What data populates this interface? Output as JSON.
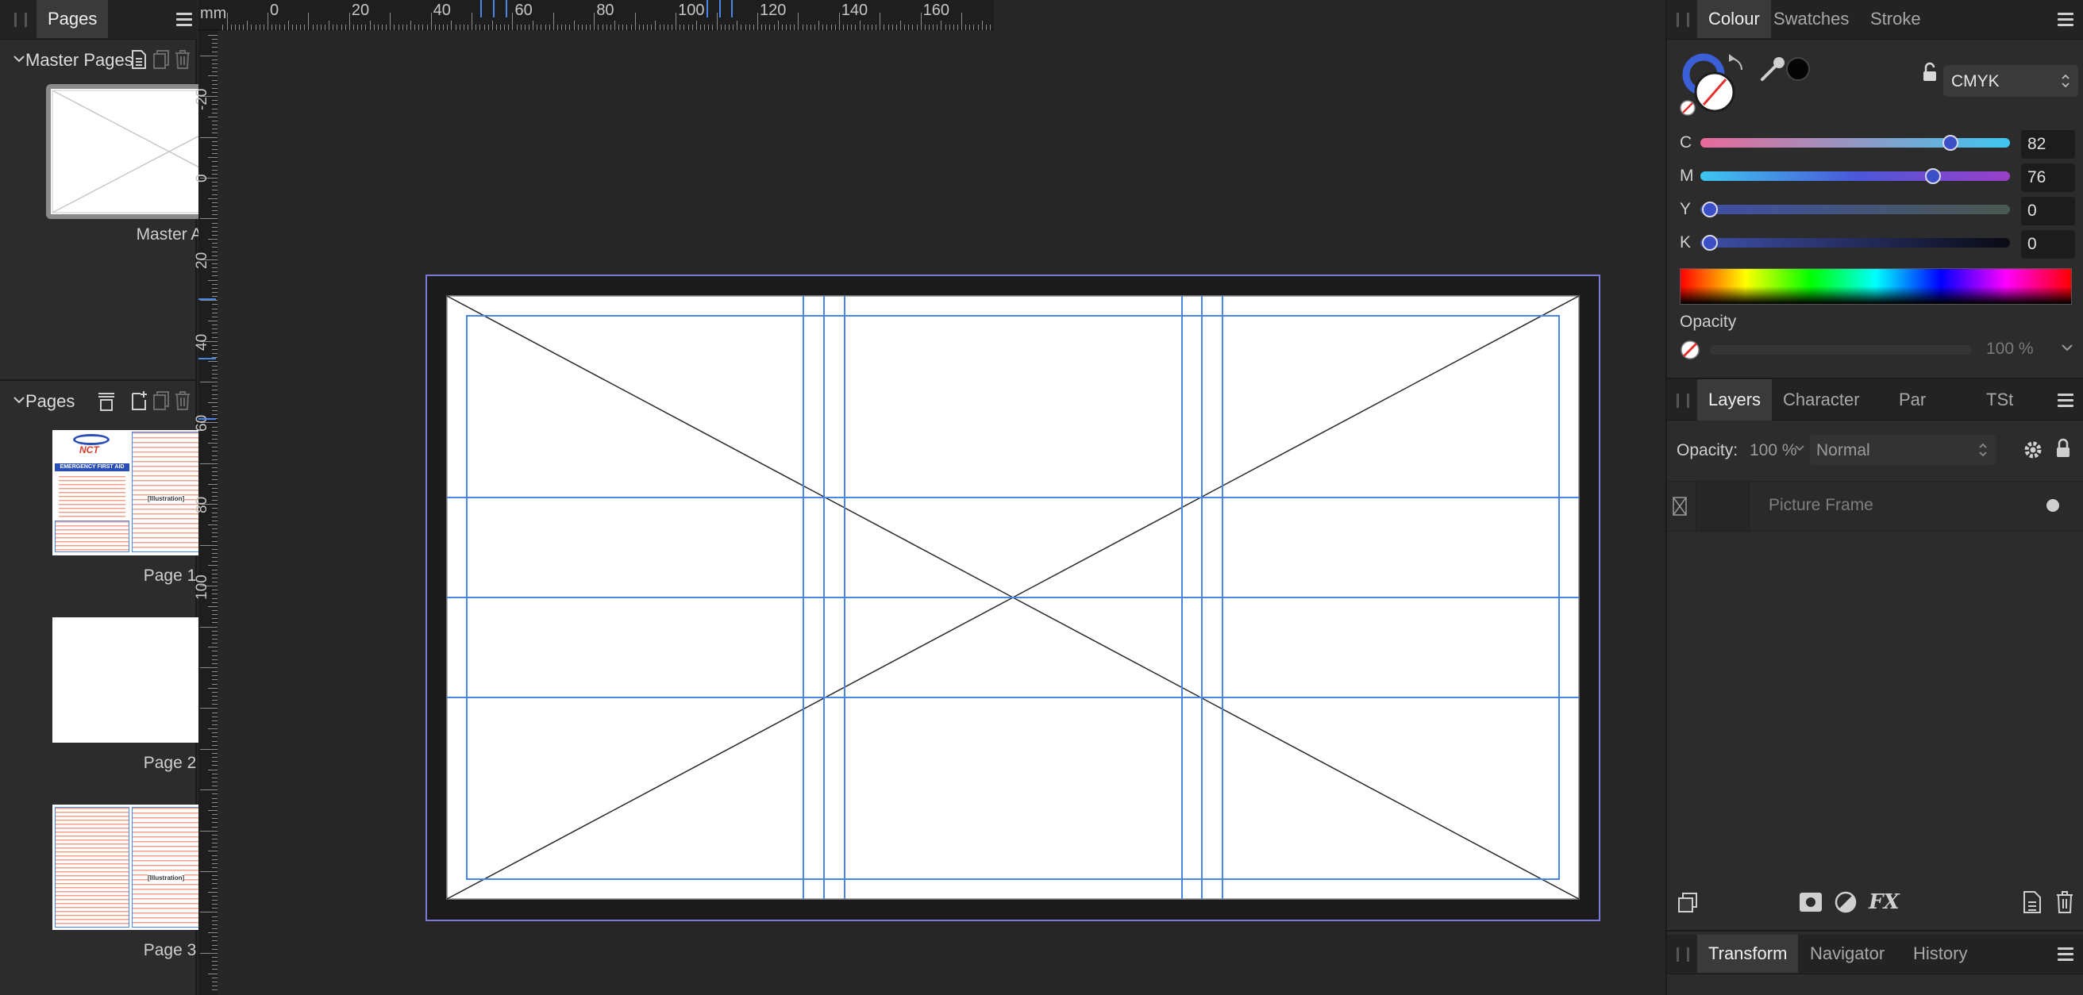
{
  "pages_panel": {
    "tab_label": "Pages",
    "master_section_title": "Master Pages",
    "master_pages": [
      {
        "label": "Master A"
      }
    ],
    "pages_section_title": "Pages",
    "pages": [
      {
        "label": "Page 1"
      },
      {
        "label": "Page 2"
      },
      {
        "label": "Page 3"
      }
    ],
    "page1_thumb": {
      "logo": "NCT",
      "banner": "EMERGENCY FIRST AID",
      "illustration": "[Illustration]"
    },
    "page3_thumb": {
      "illustration": "[Illustration]"
    }
  },
  "ruler": {
    "unit": "mm",
    "top_labels": [
      "0",
      "20",
      "40",
      "60",
      "80",
      "100",
      "120",
      "140",
      "160"
    ],
    "left_labels": [
      "-20",
      "0",
      "20",
      "40",
      "60",
      "80",
      "100"
    ]
  },
  "colour_panel": {
    "tabs": [
      "Colour",
      "Swatches",
      "Stroke"
    ],
    "active_tab": "Colour",
    "colour_model": "CMYK",
    "sliders": [
      {
        "label": "C",
        "value": "82",
        "fraction": 0.82
      },
      {
        "label": "M",
        "value": "76",
        "fraction": 0.76
      },
      {
        "label": "Y",
        "value": "0",
        "fraction": 0
      },
      {
        "label": "K",
        "value": "0",
        "fraction": 0
      }
    ],
    "opacity_label": "Opacity",
    "opacity_value": "100 %"
  },
  "layers_panel": {
    "tabs": [
      "Layers",
      "Character",
      "Par",
      "TSt"
    ],
    "active_tab": "Layers",
    "opacity_label": "Opacity:",
    "opacity_value": "100 %",
    "blend_mode": "Normal",
    "layers": [
      {
        "name": "Picture Frame"
      }
    ]
  },
  "bottom_panel": {
    "tabs": [
      "Transform",
      "Navigator",
      "History"
    ],
    "active_tab": "Transform"
  },
  "colors": {
    "guide_blue": "#4a86e8",
    "bleed_purple": "#7a78d8",
    "accent_blue": "#3b5fd6"
  }
}
